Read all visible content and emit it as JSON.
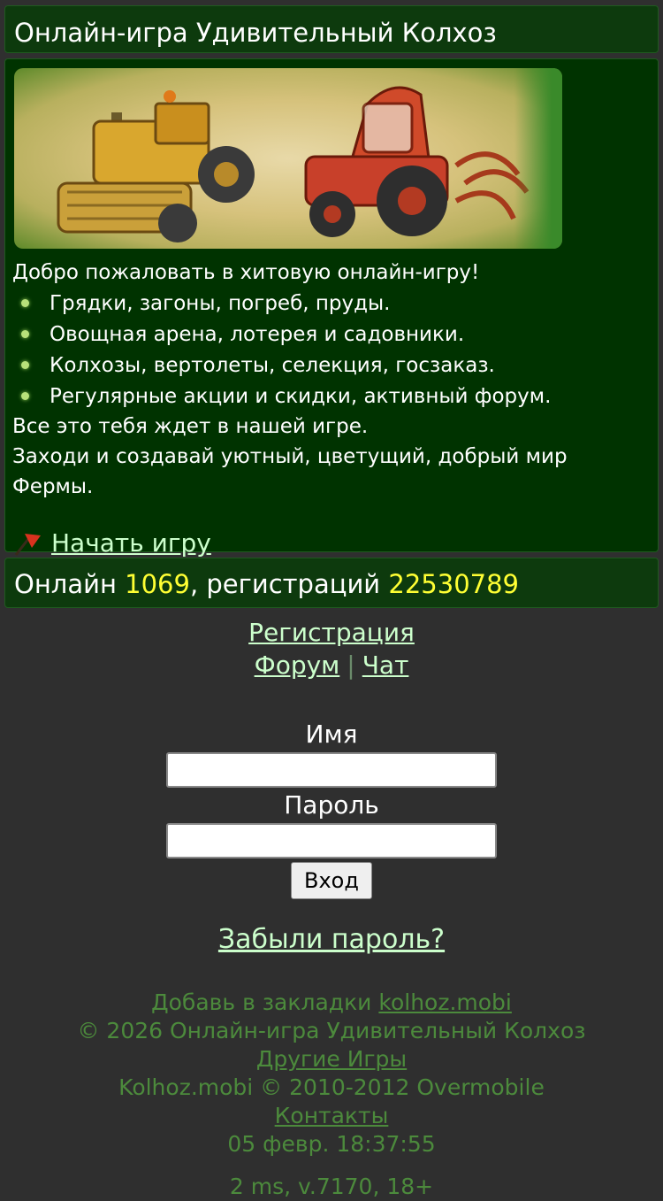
{
  "header": {
    "title": "Онлайн-игра Удивительный Колхоз"
  },
  "intro": {
    "welcome": "Добро пожаловать в хитовую онлайн-игру!",
    "features": [
      "Грядки, загоны, погреб, пруды.",
      "Овощная арена, лотерея и садовники.",
      "Колхозы, вертолеты, селекция, госзаказ.",
      "Регулярные акции и скидки, активный форум."
    ],
    "line1": "Все это тебя ждет в нашей игре.",
    "line2": "Заходи и создавай уютный, цветущий, добрый мир Фермы.",
    "start_label": "Начать игру"
  },
  "stats": {
    "online_label": "Онлайн",
    "online_count": "1069",
    "reg_label": ", регистраций",
    "reg_count": "22530789"
  },
  "nav": {
    "register": "Регистрация",
    "forum": "Форум",
    "separator": "|",
    "chat": "Чат"
  },
  "login": {
    "name_label": "Имя",
    "name_value": "",
    "password_label": "Пароль",
    "password_value": "",
    "submit": "Вход",
    "forgot": "Забыли пароль?"
  },
  "footer": {
    "bookmark_prefix": "Добавь в закладки",
    "bookmark_link": "kolhoz.mobi",
    "copyright": "© 2026 Онлайн-игра Удивительный Колхоз",
    "other_games": "Другие Игры",
    "credit": "Kolhoz.mobi © 2010-2012 Overmobile",
    "contacts": "Контакты",
    "datetime": "05 февр. 18:37:55",
    "cut_line": "2 ms, v.7170, 18+"
  },
  "colors": {
    "background": "#2f2f2f",
    "panel": "#003300",
    "highlight_number": "#ffff33",
    "link": "#ccffcc",
    "footer_text": "#4c8a3c"
  },
  "icons": {
    "start": "red-flag-icon",
    "bullet": "green-dot-icon"
  }
}
